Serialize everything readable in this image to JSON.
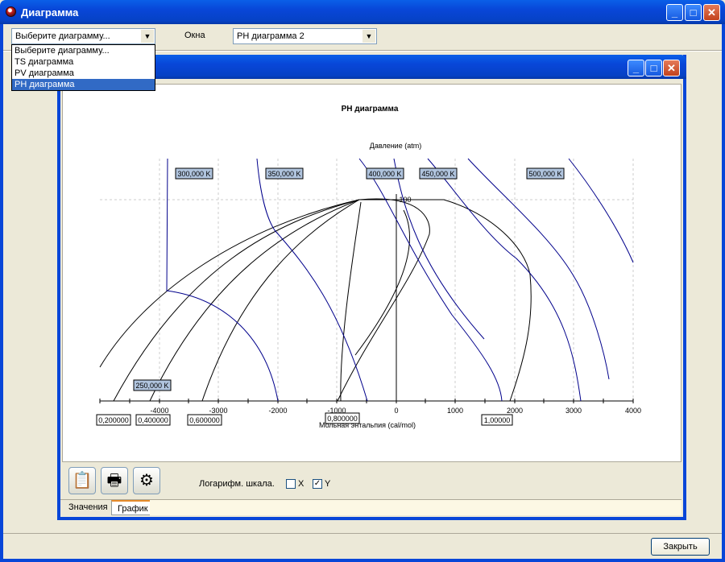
{
  "window": {
    "title": "Диаграмма"
  },
  "toolbar": {
    "diagram_select": "Выберите диаграмму...",
    "windows_label": "Окна",
    "windows_select": "PH диаграмма 2"
  },
  "dropdown": {
    "options": [
      "Выберите диаграмму...",
      "TS диаграмма",
      "PV диаграмма",
      "PH диаграмма"
    ],
    "selected_index": 3
  },
  "chart_data": {
    "type": "line",
    "title": "PH диаграмма",
    "xlabel": "Мольная энтальпия (cal/mol)",
    "ylabel": "Давление (atm)",
    "xlim": [
      -5000,
      4000
    ],
    "x_ticks": [
      "-4000",
      "-3000",
      "-2000",
      "-1000",
      "0",
      "1000",
      "2000",
      "3000",
      "4000"
    ],
    "y_tick_label": "100",
    "isotherm_labels": [
      "250,000 K",
      "300,000 K",
      "350,000 K",
      "400,000 K",
      "450,000 K",
      "500,000 K"
    ],
    "quality_labels": [
      "0,200000",
      "0,400000",
      "0,600000",
      "0,800000",
      "1,00000"
    ],
    "series_colors": {
      "isotherms": "#00008b",
      "quality_lines": "#000000"
    }
  },
  "controls": {
    "log_scale_label": "Логарифм. шкала.",
    "x_label": "X",
    "y_label": "Y",
    "x_checked": false,
    "y_checked": true
  },
  "tabs": [
    "Значения",
    "График"
  ],
  "close_button": "Закрыть"
}
